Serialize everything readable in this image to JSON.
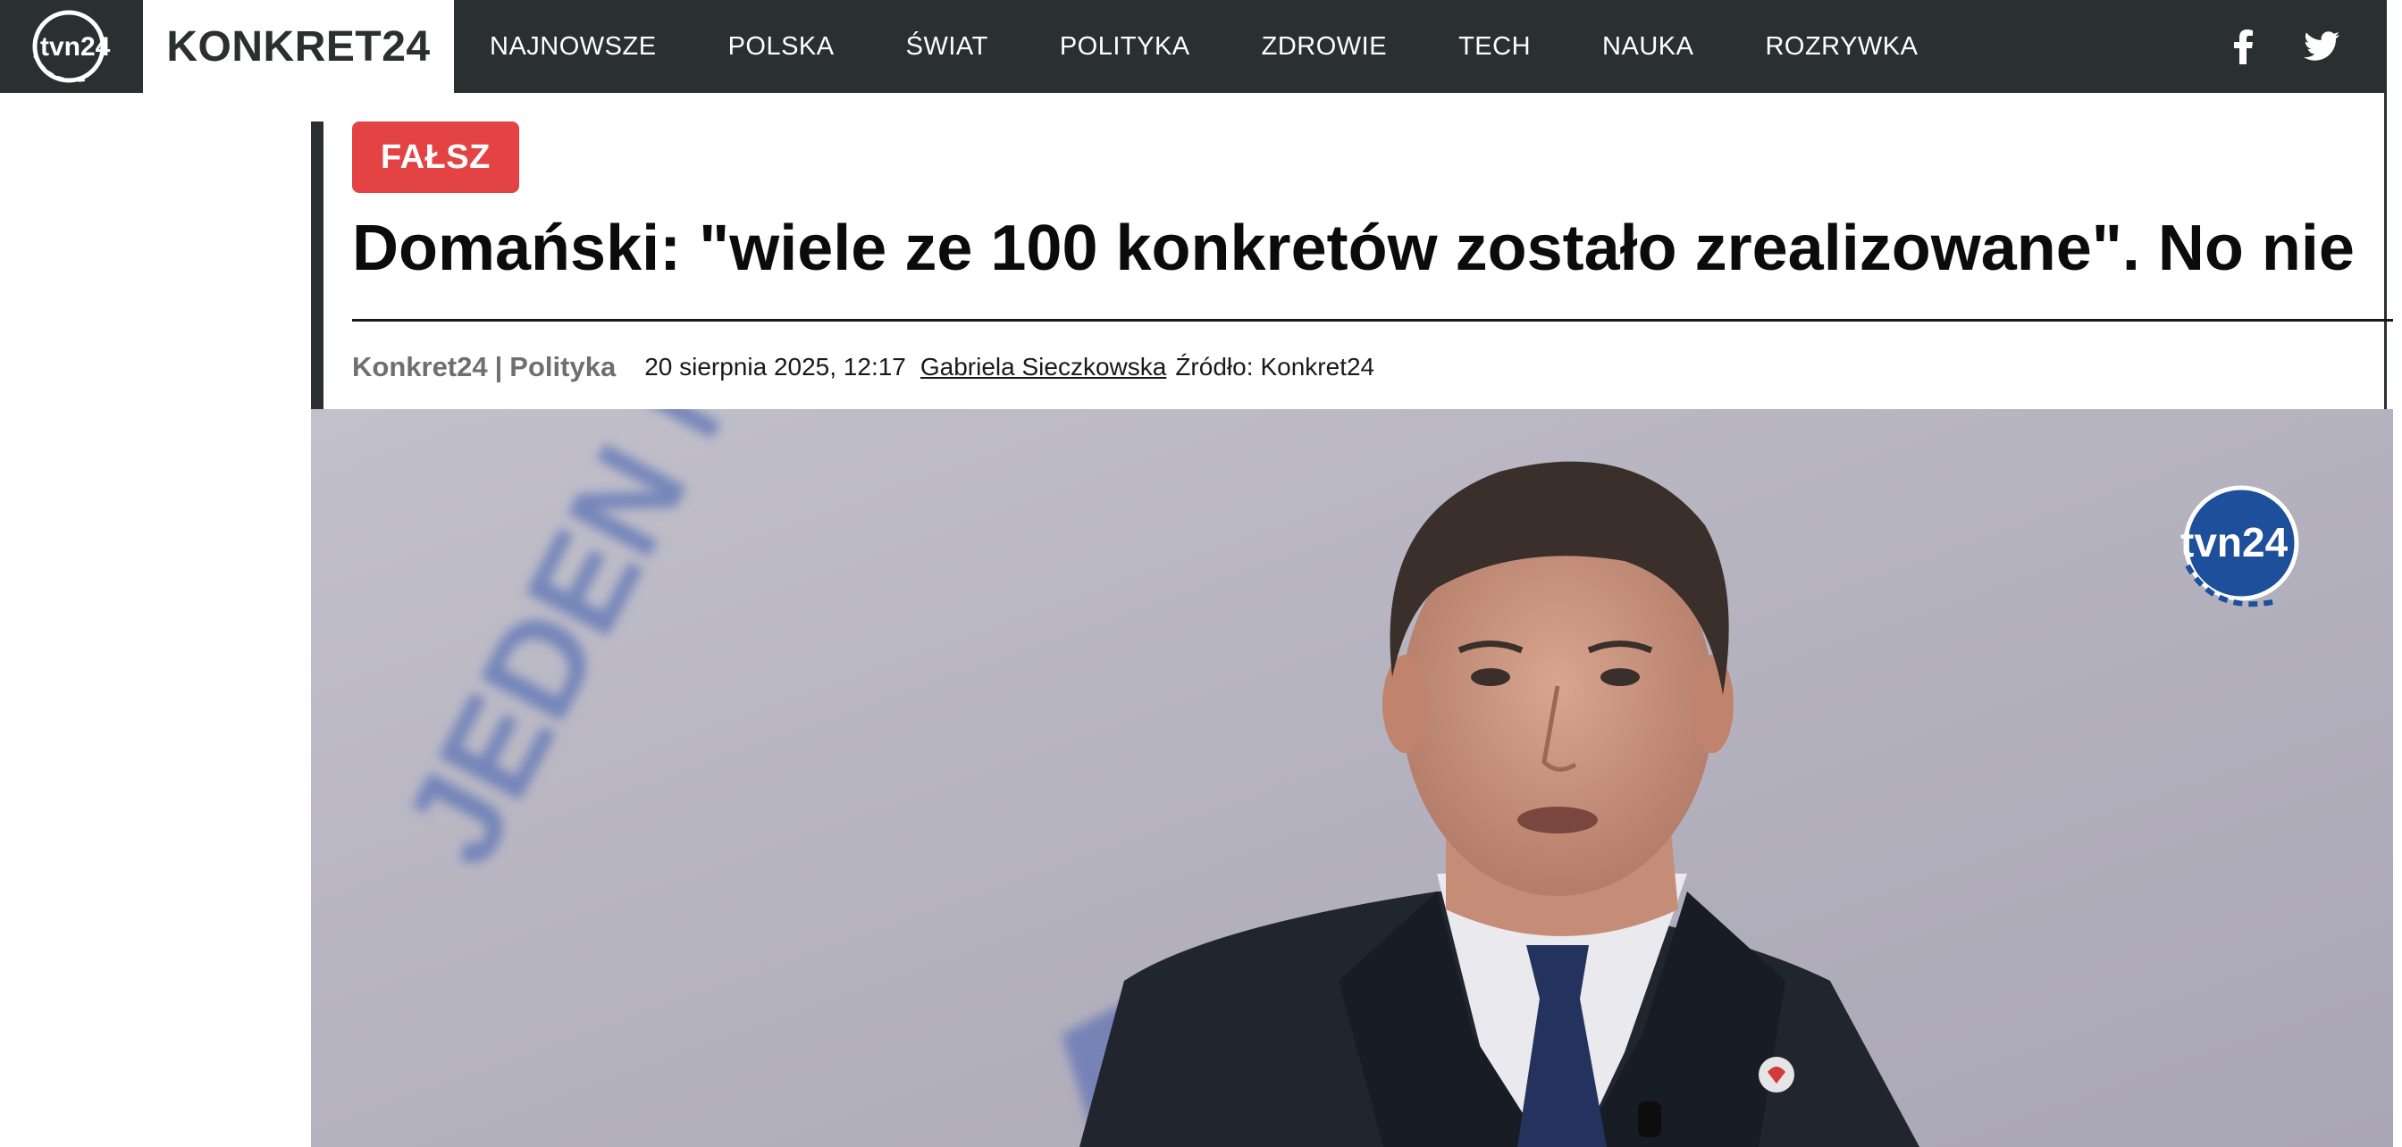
{
  "header": {
    "logo_text": "tvn24",
    "brand": "KONKRET24",
    "nav": [
      {
        "label": "NAJNOWSZE"
      },
      {
        "label": "POLSKA"
      },
      {
        "label": "ŚWIAT"
      },
      {
        "label": "POLITYKA"
      },
      {
        "label": "ZDROWIE"
      },
      {
        "label": "TECH"
      },
      {
        "label": "NAUKA"
      },
      {
        "label": "ROZRYWKA"
      }
    ],
    "social": [
      "facebook-icon",
      "twitter-icon"
    ]
  },
  "article": {
    "verdict": "FAŁSZ",
    "title": "Domański: \"wiele ze 100 konkretów zostało zrealizowane\". No nie",
    "meta": {
      "section": "Konkret24",
      "separator": "|",
      "category": "Polityka",
      "date": "20 sierpnia 2025, 12:17",
      "author": "Gabriela Sieczkowska",
      "source_label": "Źródło:",
      "source": "Konkret24"
    }
  },
  "hero": {
    "background_text": "JEDEN NA JEDEN",
    "watermark": "tvn24"
  },
  "colors": {
    "nav_bg": "#2a2f30",
    "badge_bg": "#e34343",
    "meta_gray": "#6f6f6f",
    "tvn_blue": "#1d4f9a"
  }
}
